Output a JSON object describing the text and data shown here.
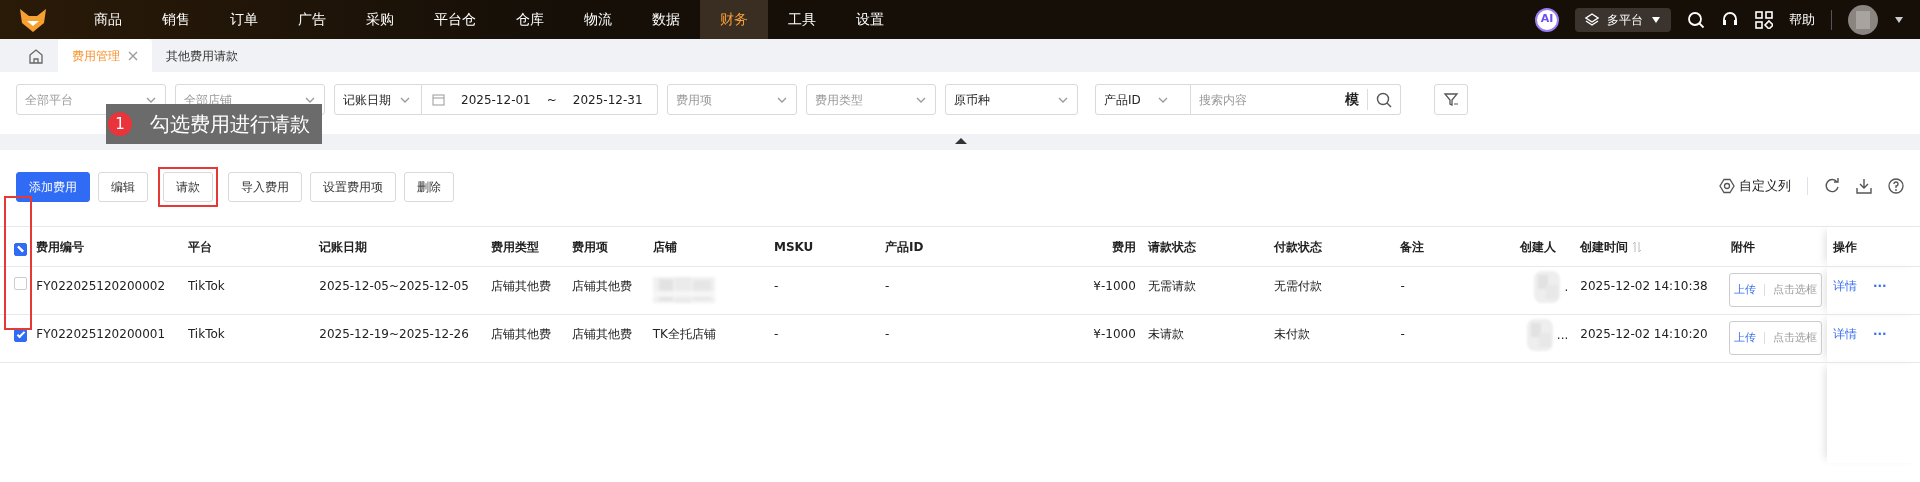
{
  "nav": {
    "items": [
      {
        "label": "商品",
        "selected": false
      },
      {
        "label": "销售",
        "selected": false
      },
      {
        "label": "订单",
        "selected": false
      },
      {
        "label": "广告",
        "selected": false
      },
      {
        "label": "采购",
        "selected": false
      },
      {
        "label": "平台仓",
        "selected": false
      },
      {
        "label": "仓库",
        "selected": false
      },
      {
        "label": "物流",
        "selected": false
      },
      {
        "label": "数据",
        "selected": false
      },
      {
        "label": "财务",
        "selected": true
      },
      {
        "label": "工具",
        "selected": false
      },
      {
        "label": "设置",
        "selected": false
      }
    ],
    "ai": "AI",
    "platform": "多平台",
    "help": "帮助"
  },
  "tabs": [
    {
      "label": "费用管理",
      "selected": true
    },
    {
      "label": "其他费用请款",
      "selected": false
    }
  ],
  "filters": [
    {
      "kind": "select",
      "placeholder": "全部平台"
    },
    {
      "kind": "select",
      "placeholder": "全部店铺"
    },
    {
      "kind": "daterange",
      "label": "记账日期",
      "start": "2025-12-01",
      "separator": "~",
      "end": "2025-12-31"
    },
    {
      "kind": "select",
      "placeholder": "费用项"
    },
    {
      "kind": "select",
      "placeholder": "费用类型"
    },
    {
      "kind": "select",
      "value": "原币种"
    },
    {
      "kind": "search",
      "label": "产品ID",
      "placeholder": "搜索内容",
      "mode": "模"
    }
  ],
  "tooltip": {
    "step": "1",
    "text": "勾选费用进行请款"
  },
  "toolbar": {
    "buttons": [
      {
        "label": "添加费用",
        "primary": true,
        "highlighted": false
      },
      {
        "label": "编辑",
        "primary": false,
        "highlighted": false
      },
      {
        "label": "请款",
        "primary": false,
        "highlighted": true
      },
      {
        "label": "导入费用",
        "primary": false,
        "highlighted": false
      },
      {
        "label": "设置费用项",
        "primary": false,
        "highlighted": false
      },
      {
        "label": "删除",
        "primary": false,
        "highlighted": false
      }
    ],
    "custom_columns": "自定义列"
  },
  "table": {
    "header_partial": true,
    "select_column_highlighted": true,
    "columns": [
      {
        "label": "费用编号"
      },
      {
        "label": "平台"
      },
      {
        "label": "记账日期"
      },
      {
        "label": "费用类型"
      },
      {
        "label": "费用项"
      },
      {
        "label": "店铺"
      },
      {
        "label": "MSKU"
      },
      {
        "label": "产品ID"
      },
      {
        "label": "费用"
      },
      {
        "label": "请款状态"
      },
      {
        "label": "付款状态"
      },
      {
        "label": "备注"
      },
      {
        "label": "创建人"
      },
      {
        "label": "创建时间"
      },
      {
        "label": "附件"
      },
      {
        "label": "操作"
      }
    ],
    "rows": [
      {
        "selected": false,
        "id": "FY022025120200002",
        "platform": "TikTok",
        "date": "2025-12-05~2025-12-05",
        "type": "店铺其他费",
        "item": "店铺其他费",
        "msku": "-",
        "product_id": "-",
        "amount": "¥-1000",
        "request_status": "无需请款",
        "payment_status": "无需付款",
        "note": "-",
        "creator": ".",
        "created": "2025-12-02 14:10:38",
        "upload": "上传",
        "attach_hint": "点击选框",
        "detail": "详情",
        "more": "···"
      },
      {
        "selected": true,
        "id": "FY022025120200001",
        "platform": "TikTok",
        "date": "2025-12-19~2025-12-26",
        "type": "店铺其他费",
        "item": "店铺其他费",
        "shop": {
          "kind": "text",
          "text": "TK全托店铺"
        },
        "msku": "-",
        "product_id": "-",
        "amount": "¥-1000",
        "request_status": "未请款",
        "payment_status": "未付款",
        "note": "-",
        "creator": "...",
        "created": "2025-12-02 14:10:20",
        "upload": "上传",
        "attach_hint": "点击选框",
        "detail": "详情",
        "more": "···"
      }
    ]
  }
}
